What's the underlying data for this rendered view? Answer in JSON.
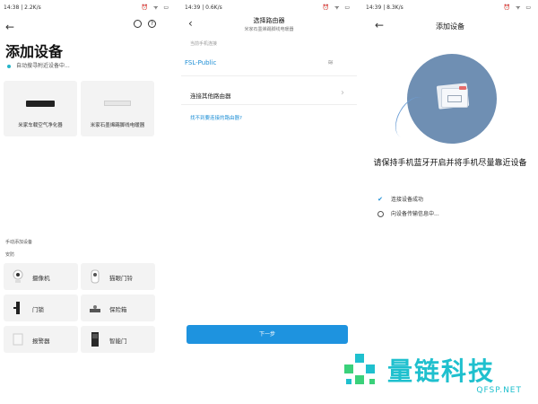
{
  "screen1": {
    "status": {
      "time": "14:38 | 2.2K/s",
      "icons": "⏰ ᯤ ▭"
    },
    "title": "添加设备",
    "searching_text": "自动搜寻附近设备中...",
    "found_devices": [
      {
        "name": "米家车载空气净化器",
        "icon": "purifier-icon"
      },
      {
        "name": "米家石墨烯踢脚线电暖器",
        "icon": "heater-icon"
      }
    ],
    "manual_label": "手动添加设备",
    "category_label": "安防",
    "tiles": [
      {
        "label": "摄像机",
        "icon": "camera-icon"
      },
      {
        "label": "猫眼门铃",
        "icon": "doorbell-icon"
      },
      {
        "label": "门锁",
        "icon": "lock-icon"
      },
      {
        "label": "保险箱",
        "icon": "safe-icon"
      },
      {
        "label": "报警器",
        "icon": "alarm-icon"
      },
      {
        "label": "智能门",
        "icon": "door-icon"
      }
    ]
  },
  "screen2": {
    "status": {
      "time": "14:39 | 0.6K/s",
      "icons": "⏰ ᯤ ▭"
    },
    "title": "选择路由器",
    "subtitle": "米家石墨烯踢脚线电暖器",
    "current_label": "当前手机连接",
    "wifi_name": "FSL-Public",
    "other_router": "连接其他路由器",
    "help_link": "找不到要连接的路由器?",
    "next_button": "下一步"
  },
  "screen3": {
    "status": {
      "time": "14:39 | 8.3K/s",
      "icons": "⏰ ᯤ ▭"
    },
    "title": "添加设备",
    "instruction": "请保持手机蓝牙开启并将手机尽量靠近设备",
    "steps": [
      {
        "text": "连接设备成功",
        "state": "done"
      },
      {
        "text": "向设备传输信息中...",
        "state": "in-progress"
      }
    ]
  },
  "watermark": {
    "cn": "量链科技",
    "en": "QFSP.NET"
  },
  "colors": {
    "accent": "#1e93df",
    "teal": "#1fc0ce",
    "illustration": "#6f8fb3"
  }
}
